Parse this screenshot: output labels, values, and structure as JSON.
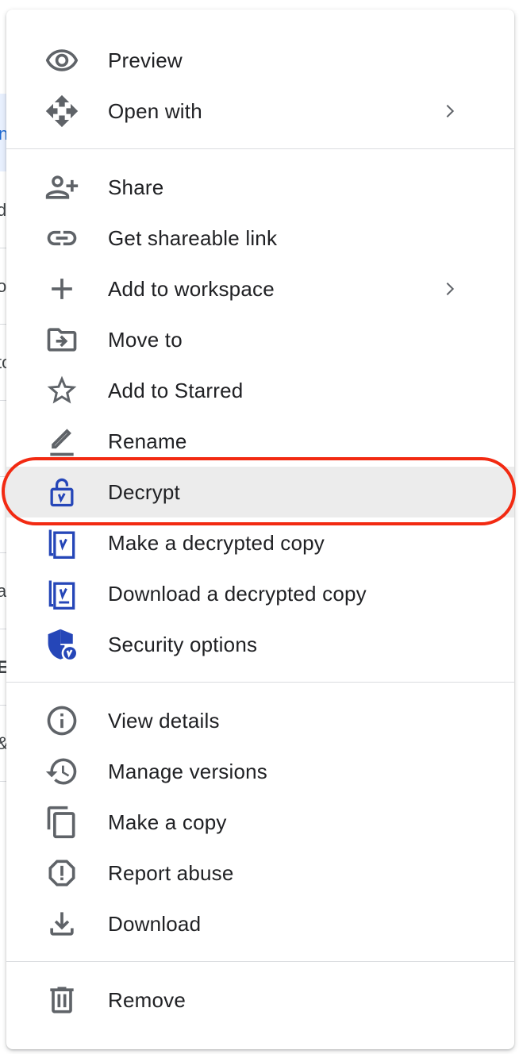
{
  "background": {
    "edge_glyphs": [
      "n",
      "d",
      "o",
      "to",
      "",
      "",
      "a,",
      "E",
      "&",
      ""
    ]
  },
  "menu": {
    "sections": [
      {
        "items": [
          {
            "id": "preview",
            "label": "Preview",
            "icon": "eye-icon",
            "submenu": false
          },
          {
            "id": "open-with",
            "label": "Open with",
            "icon": "move-arrows-icon",
            "submenu": true
          }
        ]
      },
      {
        "items": [
          {
            "id": "share",
            "label": "Share",
            "icon": "person-add-icon",
            "submenu": false
          },
          {
            "id": "get-link",
            "label": "Get shareable link",
            "icon": "link-icon",
            "submenu": false
          },
          {
            "id": "add-workspace",
            "label": "Add to workspace",
            "icon": "plus-icon",
            "submenu": true
          },
          {
            "id": "move-to",
            "label": "Move to",
            "icon": "folder-move-icon",
            "submenu": false
          },
          {
            "id": "add-starred",
            "label": "Add to Starred",
            "icon": "star-icon",
            "submenu": false
          },
          {
            "id": "rename",
            "label": "Rename",
            "icon": "pencil-icon",
            "submenu": false
          },
          {
            "id": "decrypt",
            "label": "Decrypt",
            "icon": "unlock-icon",
            "submenu": false,
            "highlighted": true
          },
          {
            "id": "decrypted-copy",
            "label": "Make a decrypted copy",
            "icon": "decrypted-copy-icon",
            "submenu": false
          },
          {
            "id": "download-decrypted",
            "label": "Download a decrypted copy",
            "icon": "download-decrypted-icon",
            "submenu": false
          },
          {
            "id": "security-options",
            "label": "Security options",
            "icon": "shield-icon",
            "submenu": false
          }
        ]
      },
      {
        "items": [
          {
            "id": "view-details",
            "label": "View details",
            "icon": "info-icon",
            "submenu": false
          },
          {
            "id": "manage-versions",
            "label": "Manage versions",
            "icon": "history-icon",
            "submenu": false
          },
          {
            "id": "make-copy",
            "label": "Make a copy",
            "icon": "copy-icon",
            "submenu": false
          },
          {
            "id": "report-abuse",
            "label": "Report abuse",
            "icon": "report-icon",
            "submenu": false
          },
          {
            "id": "download",
            "label": "Download",
            "icon": "download-icon",
            "submenu": false
          }
        ]
      },
      {
        "items": [
          {
            "id": "remove",
            "label": "Remove",
            "icon": "trash-icon",
            "submenu": false
          }
        ]
      }
    ]
  },
  "colors": {
    "icon_gray": "#5f6368",
    "icon_blue": "#2546b8",
    "highlight_bg": "#ececec",
    "annotation_red": "#f22a12",
    "text": "#202124"
  }
}
